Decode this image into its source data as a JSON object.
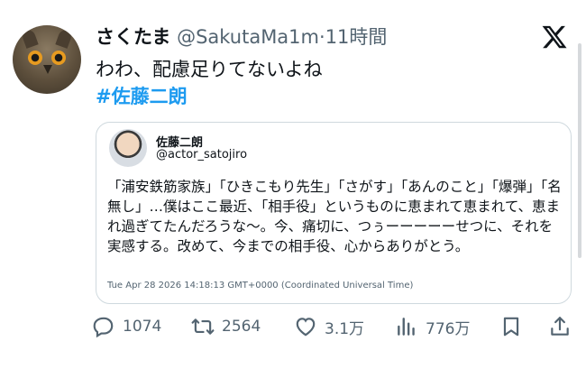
{
  "tweet": {
    "display_name": "さくたま",
    "handle": "@SakutaMa1m",
    "separator": "·",
    "time_ago": "11時間",
    "text": "わわ、配慮足りてないよね",
    "hashtag": "#佐藤二朗"
  },
  "quoted": {
    "name": "佐藤二朗",
    "handle": "@actor_satojiro",
    "body": "「浦安鉄筋家族」「ひきこもり先生」「さがす」「あんのこと」「爆弾」「名無し」…僕はここ最近、「相手役」というものに恵まれて恵まれて、恵まれ過ぎてたんだろうな〜。今、痛切に、つぅーーーーーせつに、それを実感する。改めて、今までの相手役、心からありがとう。",
    "timestamp": "Tue Apr 28 2026 14:18:13 GMT+0000 (Coordinated Universal Time)"
  },
  "actions": {
    "replies": "1074",
    "retweets": "2564",
    "likes": "3.1万",
    "views": "776万"
  },
  "icons": [
    "x-logo-icon",
    "reply-icon",
    "retweet-icon",
    "like-icon",
    "views-icon",
    "bookmark-icon",
    "share-icon"
  ],
  "colors": {
    "link": "#1d9bf0",
    "muted": "#536471",
    "text": "#0f1419",
    "border": "#cfd9de"
  }
}
